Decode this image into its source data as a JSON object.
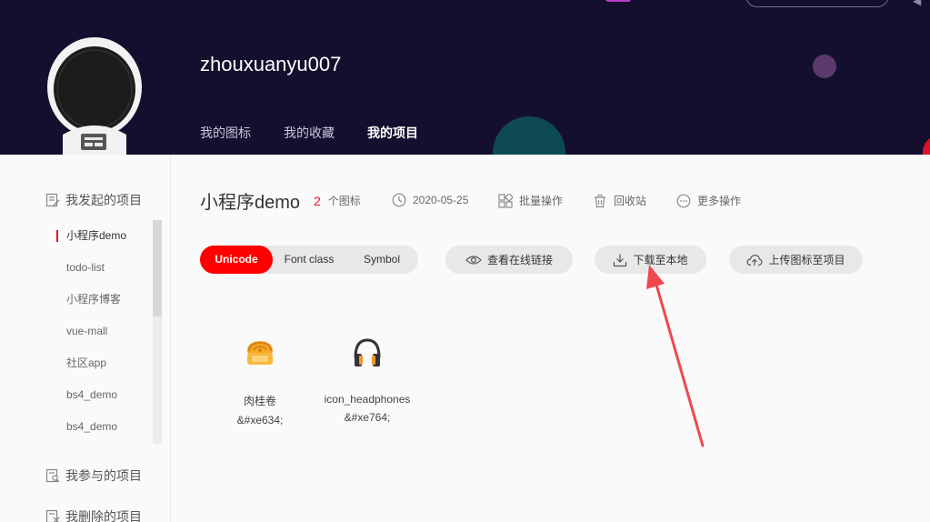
{
  "header": {
    "username": "zhouxuanyu007",
    "tabs": [
      {
        "label": "我的图标"
      },
      {
        "label": "我的收藏"
      },
      {
        "label": "我的项目"
      }
    ]
  },
  "sidebar": {
    "groups": [
      {
        "label": "我发起的项目"
      },
      {
        "label": "我参与的项目"
      },
      {
        "label": "我删除的项目"
      }
    ],
    "items": [
      {
        "label": "小程序demo"
      },
      {
        "label": "todo-list"
      },
      {
        "label": "小程序博客"
      },
      {
        "label": "vue-mall"
      },
      {
        "label": "社区app"
      },
      {
        "label": "bs4_demo"
      },
      {
        "label": "bs4_demo"
      }
    ]
  },
  "project": {
    "title": "小程序demo",
    "icon_count": "2",
    "icon_count_suffix": "个图标",
    "date": "2020-05-25",
    "batch_label": "批量操作",
    "recycle_label": "回收站",
    "more_label": "更多操作"
  },
  "toolbar": {
    "formats": [
      {
        "label": "Unicode"
      },
      {
        "label": "Font class"
      },
      {
        "label": "Symbol"
      }
    ],
    "view_link_label": "查看在线链接",
    "download_label": "下载至本地",
    "upload_label": "上传图标至项目"
  },
  "icons": [
    {
      "name": "肉桂卷",
      "code": "&#xe634;"
    },
    {
      "name": "icon_headphones",
      "code": "&#xe764;"
    }
  ],
  "colors": {
    "accent": "#ff0000",
    "header_bg": "#140f2e",
    "annotation_arrow": "#f0484e"
  }
}
